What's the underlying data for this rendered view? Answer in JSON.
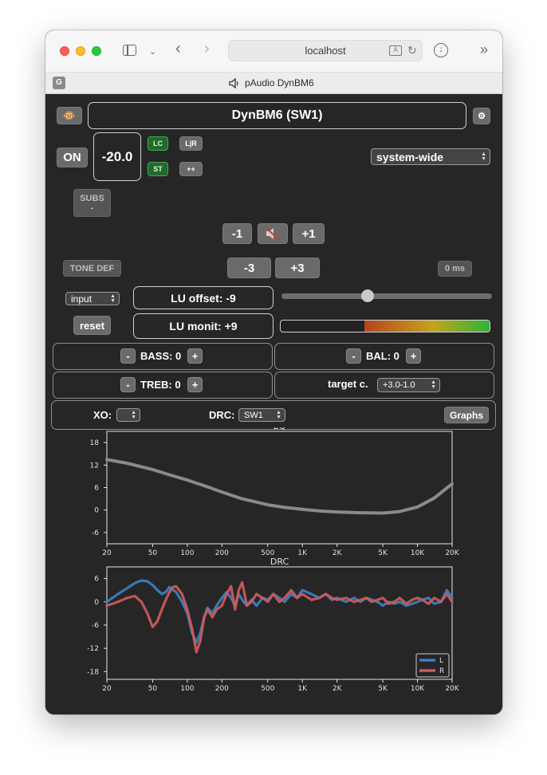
{
  "browser": {
    "url": "localhost",
    "tab_badge": "G",
    "tab_title": "pAudio DynBM6"
  },
  "header": {
    "title": "DynBM6 (SW1)"
  },
  "controls": {
    "on_label": "ON",
    "volume_value": "-20.0",
    "lc_label": "LC",
    "lr_label": "L|R",
    "st_label": "ST",
    "plusplus_label": "++",
    "source_select": "system-wide",
    "subs_label": "SUBS",
    "subs_value": "-",
    "minus1_label": "-1",
    "plus1_label": "+1",
    "tone_def_label": "TONE DEF",
    "minus3_label": "-3",
    "plus3_label": "+3",
    "delay_label": "0 ms",
    "input_select": "input",
    "lu_offset": "LU offset: -9",
    "reset_label": "reset",
    "lu_monit": "LU monit: +9",
    "lu_offset_slider_fraction": 0.41,
    "lu_meter_fraction": 0.6,
    "bass_minus": "-",
    "bass_label": "BASS: 0",
    "bass_plus": "+",
    "bal_minus": "-",
    "bal_label": "BAL: 0",
    "bal_plus": "+",
    "treb_minus": "-",
    "treb_label": "TREB: 0",
    "treb_plus": "+",
    "target_label": "target c.",
    "target_select": "+3.0-1.0",
    "xo_label": "XO:",
    "xo_select": "",
    "drc_label": "DRC:",
    "drc_select": "SW1",
    "graphs_label": "Graphs"
  },
  "colors": {
    "background": "#262626",
    "button": "#6a6a6a",
    "green_button": "#1f6b2a",
    "eq_curve": "#8a8a8a",
    "drc_L": "#3d7fc4",
    "drc_R": "#cf5a5a"
  },
  "icons": {
    "mute": "speaker-muted-icon",
    "settings": "gear-icon",
    "avatar": "monkey-icon"
  },
  "chart_data": [
    {
      "type": "line",
      "title": "EQ",
      "x_scale": "log",
      "xlim": [
        20,
        20000
      ],
      "ylim": [
        -9,
        21
      ],
      "xticks": [
        20,
        50,
        100,
        200,
        500,
        1000,
        2000,
        5000,
        10000,
        20000
      ],
      "xtick_labels": [
        "20",
        "50",
        "100",
        "200",
        "500",
        "1K",
        "2K",
        "5K",
        "10K",
        "20K"
      ],
      "yticks": [
        18,
        12,
        6,
        0,
        -6
      ],
      "grid": false,
      "series": [
        {
          "x": [
            20,
            30,
            50,
            70,
            100,
            150,
            200,
            300,
            500,
            700,
            1000,
            1500,
            2000,
            3000,
            5000,
            7000,
            10000,
            14000,
            20000
          ],
          "y": [
            13.5,
            12.5,
            10.8,
            9.4,
            8.0,
            6.2,
            4.8,
            3.0,
            1.4,
            0.7,
            0.2,
            -0.3,
            -0.5,
            -0.7,
            -0.8,
            -0.4,
            0.8,
            3.2,
            7.0
          ]
        }
      ]
    },
    {
      "type": "line",
      "title": "DRC",
      "x_scale": "log",
      "xlim": [
        20,
        20000
      ],
      "ylim": [
        -20,
        9
      ],
      "xticks": [
        20,
        50,
        100,
        200,
        500,
        1000,
        2000,
        5000,
        10000,
        20000
      ],
      "xtick_labels": [
        "20",
        "50",
        "100",
        "200",
        "500",
        "1K",
        "2K",
        "5K",
        "10K",
        "20K"
      ],
      "yticks": [
        6,
        0,
        -6,
        -12,
        -18
      ],
      "grid": false,
      "legend": "bottom-right",
      "series": [
        {
          "name": "L",
          "x": [
            20,
            25,
            30,
            35,
            40,
            45,
            50,
            55,
            60,
            65,
            70,
            80,
            90,
            100,
            110,
            120,
            130,
            140,
            150,
            165,
            180,
            200,
            220,
            240,
            260,
            280,
            300,
            330,
            360,
            400,
            450,
            500,
            560,
            630,
            700,
            800,
            900,
            1000,
            1200,
            1400,
            1600,
            1800,
            2000,
            2400,
            2800,
            3200,
            3600,
            4000,
            4500,
            5000,
            5600,
            6300,
            7000,
            8000,
            9000,
            10000,
            11000,
            12500,
            14000,
            16000,
            18000,
            20000
          ],
          "y": [
            0,
            2,
            3.5,
            4.8,
            5.5,
            5.3,
            4.3,
            3,
            2,
            2.5,
            3.8,
            2.5,
            0,
            -3,
            -8,
            -10.5,
            -8,
            -4,
            -1.5,
            -3,
            -1,
            1,
            2.5,
            1,
            -1,
            2,
            0.5,
            -1,
            0.5,
            -1,
            1,
            0.5,
            2,
            1,
            0,
            2,
            1,
            3,
            2,
            1,
            2,
            0.5,
            1,
            0,
            1,
            0,
            1,
            0.5,
            0,
            -1,
            0,
            -0.5,
            0,
            -1,
            -0.5,
            0,
            0.5,
            1,
            -0.5,
            0,
            3,
            1
          ]
        },
        {
          "name": "R",
          "x": [
            20,
            25,
            30,
            35,
            40,
            45,
            50,
            55,
            60,
            65,
            70,
            75,
            80,
            90,
            100,
            110,
            120,
            130,
            140,
            150,
            165,
            180,
            200,
            220,
            240,
            260,
            280,
            300,
            330,
            360,
            400,
            450,
            500,
            560,
            630,
            700,
            800,
            900,
            1000,
            1200,
            1400,
            1600,
            1800,
            2000,
            2400,
            2800,
            3200,
            3600,
            4000,
            4500,
            5000,
            5600,
            6300,
            7000,
            8000,
            9000,
            10000,
            11000,
            12500,
            14000,
            16000,
            18000,
            20000
          ],
          "y": [
            -1,
            0,
            1,
            1.5,
            0,
            -3,
            -6.5,
            -5,
            -2,
            0.5,
            2.5,
            3.8,
            4,
            2,
            -2,
            -7,
            -13,
            -10,
            -4,
            -2,
            -4,
            -2,
            -1,
            2,
            4,
            -2,
            3,
            5,
            -1,
            0,
            2,
            1,
            0,
            2,
            0,
            1,
            3,
            1,
            2,
            0.5,
            1,
            2,
            1,
            0.5,
            1,
            0,
            0.5,
            1,
            0,
            0.5,
            1,
            -0.5,
            0,
            1,
            -0.5,
            0.5,
            1,
            0.5,
            -0.5,
            1,
            0,
            2,
            0
          ]
        }
      ]
    }
  ]
}
